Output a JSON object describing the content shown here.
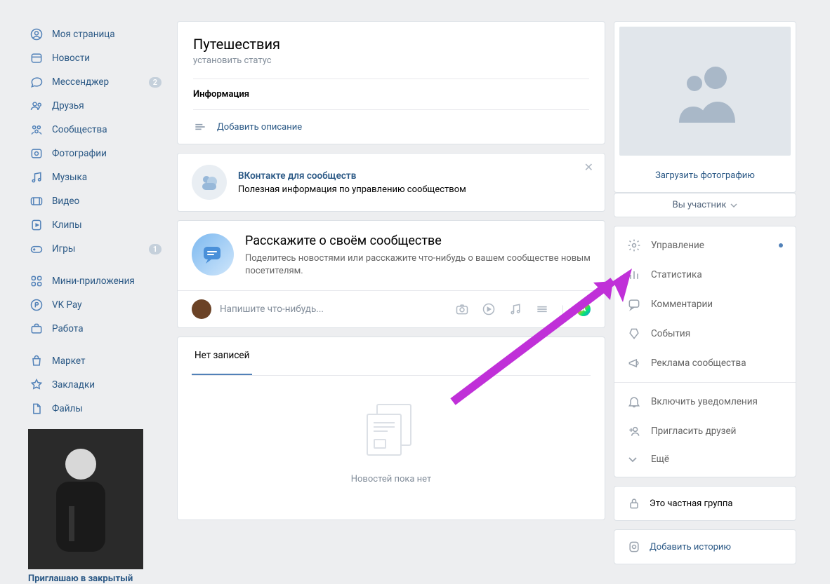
{
  "sidebar": {
    "items": [
      {
        "label": "Моя страница",
        "icon": "user-circle"
      },
      {
        "label": "Новости",
        "icon": "news"
      },
      {
        "label": "Мессенджер",
        "icon": "chat",
        "badge": "2"
      },
      {
        "label": "Друзья",
        "icon": "friends"
      },
      {
        "label": "Сообщества",
        "icon": "community"
      },
      {
        "label": "Фотографии",
        "icon": "photo"
      },
      {
        "label": "Музыка",
        "icon": "music"
      },
      {
        "label": "Видео",
        "icon": "video"
      },
      {
        "label": "Клипы",
        "icon": "clips"
      },
      {
        "label": "Игры",
        "icon": "games",
        "badge": "1"
      }
    ],
    "items2": [
      {
        "label": "Мини-приложения",
        "icon": "apps"
      },
      {
        "label": "VK Pay",
        "icon": "pay"
      },
      {
        "label": "Работа",
        "icon": "work"
      }
    ],
    "items3": [
      {
        "label": "Маркет",
        "icon": "market"
      },
      {
        "label": "Закладки",
        "icon": "bookmark"
      },
      {
        "label": "Файлы",
        "icon": "files"
      }
    ],
    "ad_caption": "Приглашаю в закрытый"
  },
  "header": {
    "title": "Путешествия",
    "status": "установить статус",
    "info": "Информация",
    "add_desc": "Добавить описание"
  },
  "promo": {
    "title": "ВКонтакте для сообществ",
    "text": "Полезная информация по управлению сообществом"
  },
  "tell": {
    "title": "Расскажите о своём сообществе",
    "sub": "Поделитесь новостями или расскажите что-нибудь о вашем сообществе новым посетителям.",
    "placeholder": "Напишите что-нибудь..."
  },
  "feed": {
    "tab": "Нет записей",
    "empty": "Новостей пока нет"
  },
  "right": {
    "upload": "Загрузить фотографию",
    "member": "Вы участник",
    "items": [
      {
        "label": "Управление",
        "dot": true
      },
      {
        "label": "Статистика"
      },
      {
        "label": "Комментарии"
      },
      {
        "label": "События"
      },
      {
        "label": "Реклама сообщества"
      },
      {
        "label": "Включить уведомления"
      },
      {
        "label": "Пригласить друзей"
      },
      {
        "label": "Ещё"
      }
    ],
    "private": "Это частная группа",
    "add_story": "Добавить историю"
  }
}
